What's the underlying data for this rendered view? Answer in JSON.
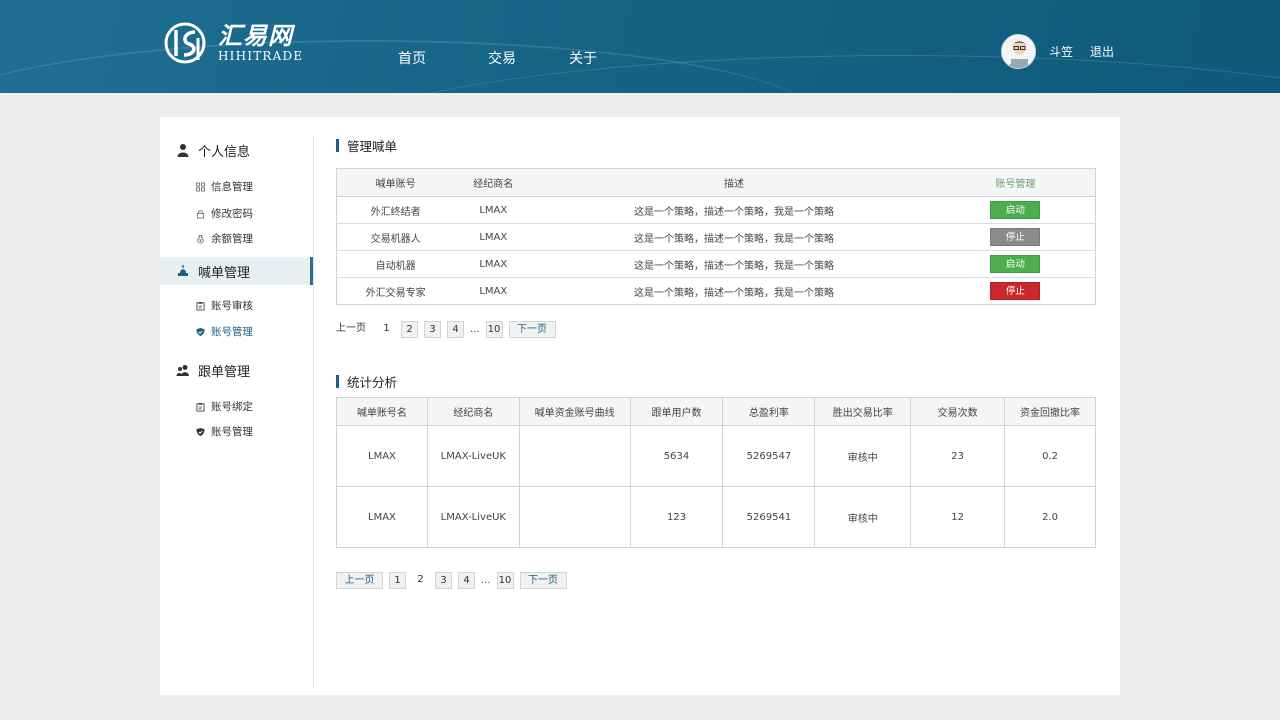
{
  "header": {
    "logo_cn": "汇易网",
    "logo_en": "HIHITRADE",
    "nav": [
      "首页",
      "交易",
      "关于"
    ],
    "user_name": "斗笠",
    "logout": "退出"
  },
  "sidebar": {
    "sections": [
      {
        "label": "个人信息",
        "icon": "user-icon",
        "items": [
          "信息管理",
          "修改密码",
          "余额管理"
        ]
      },
      {
        "label": "喊单管理",
        "icon": "megaphone-icon",
        "active": true,
        "items": [
          "账号审核",
          "账号管理"
        ],
        "active_item": "账号管理"
      },
      {
        "label": "跟单管理",
        "icon": "group-icon",
        "items": [
          "账号绑定",
          "账号管理"
        ]
      }
    ]
  },
  "manage": {
    "title": "管理喊单",
    "headers": [
      "喊单账号",
      "经纪商名",
      "描述",
      "账号管理"
    ],
    "rows": [
      {
        "account": "外汇终结者",
        "broker": "LMAX",
        "desc": "这是一个策略，描述一个策略，我是一个策略",
        "action": "启动",
        "style": "start"
      },
      {
        "account": "交易机器人",
        "broker": "LMAX",
        "desc": "这是一个策略，描述一个策略，我是一个策略",
        "action": "停止",
        "style": "stop-gray"
      },
      {
        "account": "自动机器",
        "broker": "LMAX",
        "desc": "这是一个策略，描述一个策略，我是一个策略",
        "action": "启动",
        "style": "start"
      },
      {
        "account": "外汇交易专家",
        "broker": "LMAX",
        "desc": "这是一个策略，描述一个策略，我是一个策略",
        "action": "停止",
        "style": "stop-red"
      }
    ],
    "pager": {
      "prev": "上一页",
      "pages": [
        "1",
        "2",
        "3",
        "4"
      ],
      "ellipsis": "...",
      "last": "10",
      "next": "下一页",
      "current": "1"
    }
  },
  "stats": {
    "title": "统计分析",
    "headers": [
      "喊单账号名",
      "经纪商名",
      "喊单资金账号曲线",
      "跟单用户数",
      "总盈利率",
      "胜出交易比率",
      "交易次数",
      "资金回撤比率"
    ],
    "rows": [
      [
        "LMAX",
        "LMAX-LiveUK",
        "",
        "5634",
        "5269547",
        "审核中",
        "23",
        "0.2"
      ],
      [
        "LMAX",
        "LMAX-LiveUK",
        "",
        "123",
        "5269541",
        "审核中",
        "12",
        "2.0"
      ]
    ],
    "pager": {
      "prev": "上一页",
      "pages": [
        "1",
        "2",
        "3",
        "4"
      ],
      "ellipsis": "...",
      "last": "10",
      "next": "下一页",
      "current": "2"
    }
  },
  "colors": {
    "header_bg": "#156486",
    "accent": "#1e5f85",
    "start_btn": "#4cae4f",
    "stop_gray": "#8b8b8b",
    "stop_red": "#c9282d"
  }
}
